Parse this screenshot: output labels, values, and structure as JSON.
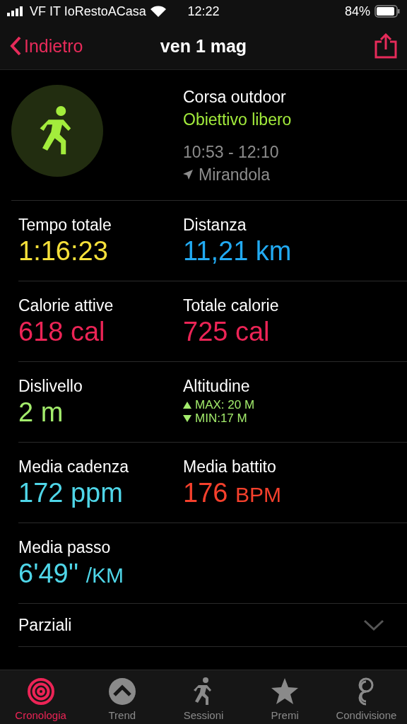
{
  "status_bar": {
    "carrier": "VF IT IoRestoACasa",
    "time": "12:22",
    "battery": "84%"
  },
  "nav": {
    "back": "Indietro",
    "title": "ven 1 mag"
  },
  "workout": {
    "type": "Corsa outdoor",
    "goal": "Obiettivo libero",
    "time_range": "10:53 - 12:10",
    "location": "Mirandola"
  },
  "metrics": [
    {
      "kind": "value",
      "label": "Tempo totale",
      "value": "1:16:23",
      "color": "#f5e03a"
    },
    {
      "kind": "value",
      "label": "Distanza",
      "value": "11,21 km",
      "color": "#22aaf2"
    },
    {
      "kind": "value",
      "label": "Calorie attive",
      "value": "618 cal",
      "color": "#ec2456"
    },
    {
      "kind": "value",
      "label": "Totale calorie",
      "value": "725 cal",
      "color": "#ec2456"
    },
    {
      "kind": "value",
      "label": "Dislivello",
      "value": "2 m",
      "color": "#a3ec6c"
    },
    {
      "kind": "range",
      "label": "Altitudine",
      "max": "MAX: 20 M",
      "min": "MIN:17 M",
      "color": "#a3ec6c"
    },
    {
      "kind": "value",
      "label": "Media cadenza",
      "value": "172 ppm",
      "color": "#4fd6e8"
    },
    {
      "kind": "value",
      "label": "Media battito",
      "value": "176",
      "unit": "BPM",
      "color": "#f5402c"
    },
    {
      "kind": "value",
      "label": "Media passo",
      "value": "6'49''",
      "unit": "/KM",
      "color": "#4fd6e8"
    }
  ],
  "sections": [
    {
      "label": "Parziali",
      "expanded": false
    }
  ],
  "tabs": [
    {
      "label": "Cronologia",
      "selected": true
    },
    {
      "label": "Trend",
      "selected": false
    },
    {
      "label": "Sessioni",
      "selected": false
    },
    {
      "label": "Premi",
      "selected": false
    },
    {
      "label": "Condivisione",
      "selected": false
    }
  ]
}
